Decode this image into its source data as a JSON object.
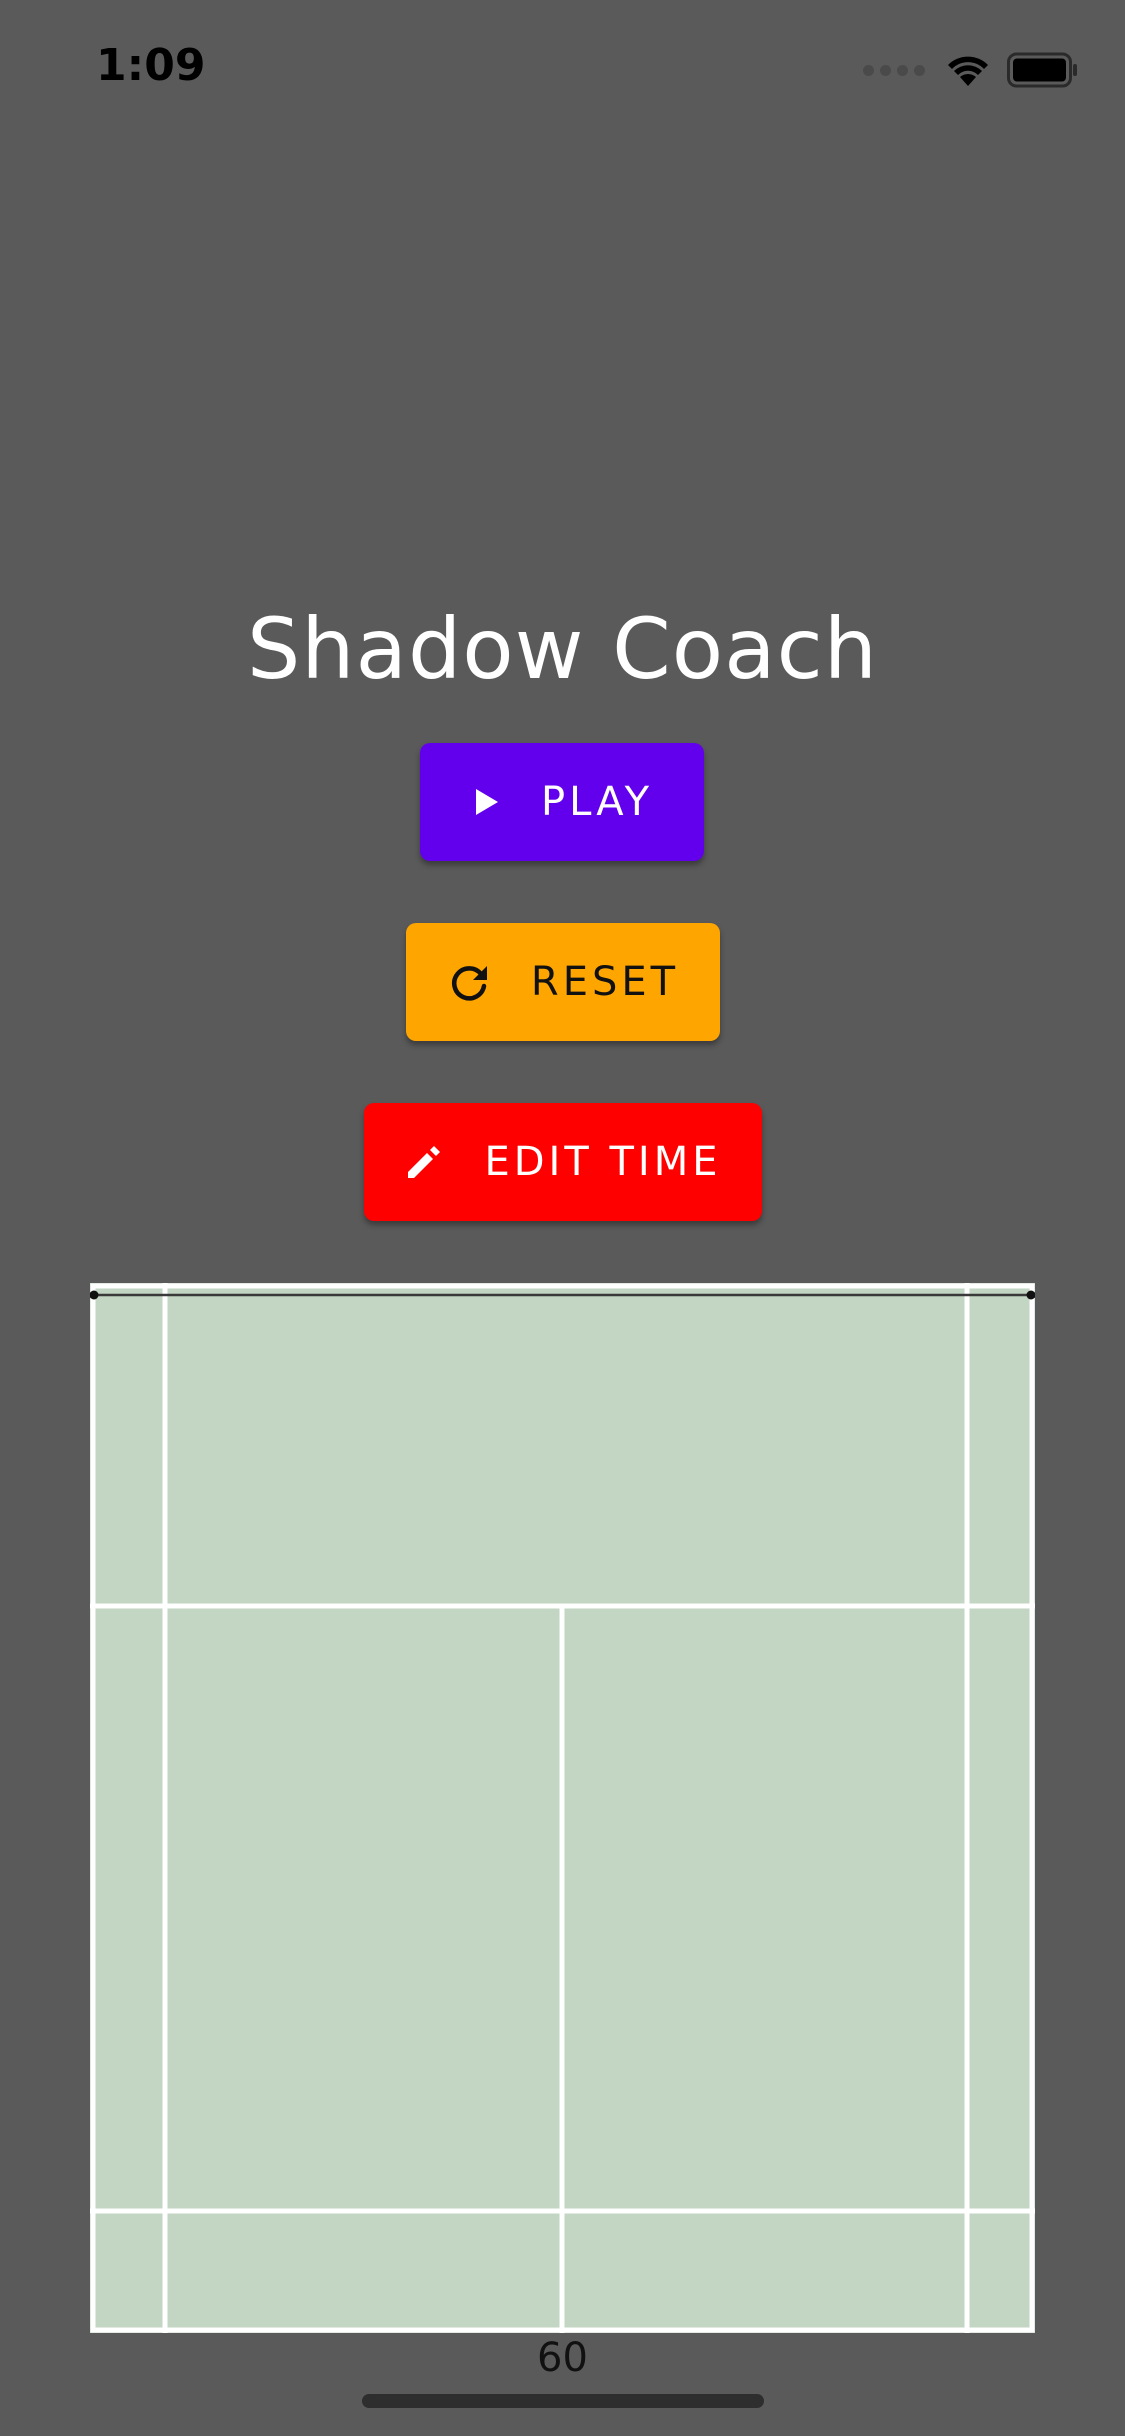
{
  "status_bar": {
    "time": "1:09",
    "signal_icon": "cellular-signal-icon",
    "wifi_icon": "wifi-icon",
    "battery_icon": "battery-icon"
  },
  "app": {
    "title": "Shadow Coach"
  },
  "buttons": {
    "play": {
      "label": "PLAY",
      "icon": "play-icon",
      "color": "#6200ee"
    },
    "reset": {
      "label": "RESET",
      "icon": "refresh-icon",
      "color": "#ffa500"
    },
    "edit_time": {
      "label": "EDIT TIME",
      "icon": "pencil-icon",
      "color": "#ff0000"
    }
  },
  "court": {
    "surface_color": "#c3d5c3",
    "line_color": "#ffffff",
    "counter": "60"
  },
  "colors": {
    "background": "#5a5a5a"
  }
}
